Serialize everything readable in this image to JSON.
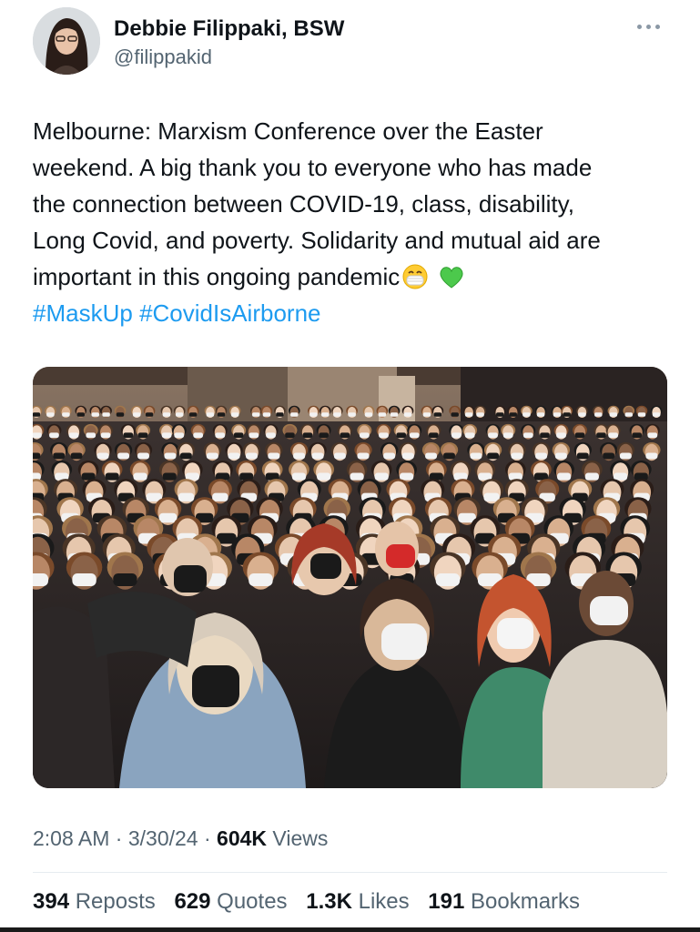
{
  "author": {
    "name": "Debbie Filippaki, BSW",
    "handle": "@filippakid"
  },
  "tweet": {
    "lines": [
      "Melbourne: Marxism Conference over the Easter",
      "weekend. A big thank you to everyone who has made",
      "the connection between COVID-19, class, disability,",
      "Long Covid, and poverty. Solidarity and mutual aid are",
      "important in this ongoing pandemic"
    ],
    "emojis": [
      "face-with-medical-mask-icon",
      "green-heart-icon"
    ],
    "hashtags": [
      "#MaskUp",
      "#CovidIsAirborne"
    ]
  },
  "photo": {
    "subject": "conference-audience-photo"
  },
  "meta": {
    "time": "2:08 AM",
    "date": "3/30/24",
    "views_count": "604K",
    "views_label": "Views",
    "separator": "·"
  },
  "stats": {
    "reposts_count": "394",
    "reposts_label": "Reposts",
    "quotes_count": "629",
    "quotes_label": "Quotes",
    "likes_count": "1.3K",
    "likes_label": "Likes",
    "bookmarks_count": "191",
    "bookmarks_label": "Bookmarks"
  },
  "colors": {
    "link": "#1d9bf0",
    "secondary_text": "#536471",
    "primary_text": "#0f1419"
  }
}
